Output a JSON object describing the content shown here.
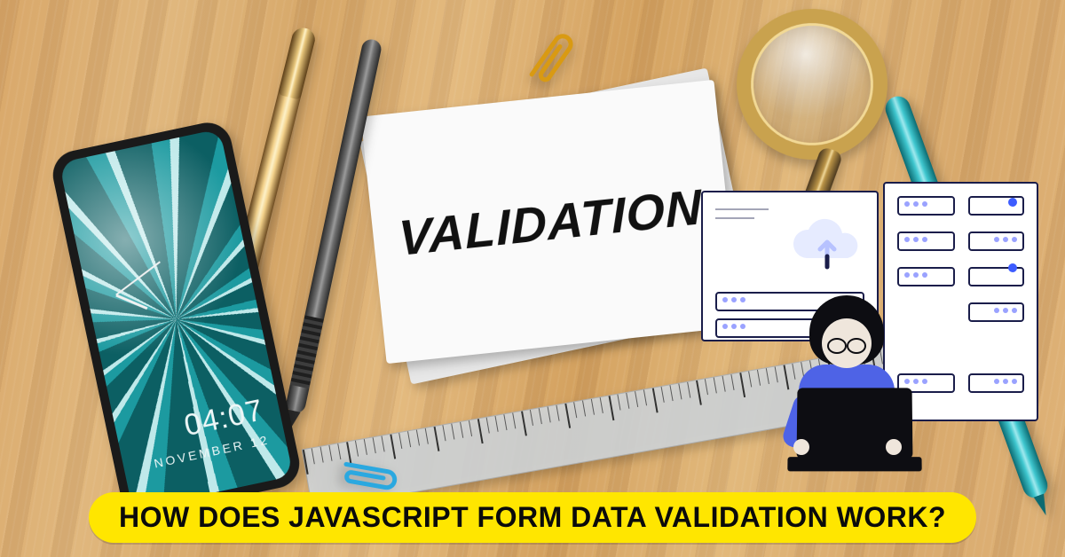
{
  "card_label": "VALIDATION",
  "caption": "HOW DOES JAVASCRIPT FORM DATA VALIDATION WORK?",
  "phone": {
    "time": "04:07",
    "date": "NOVEMBER 12"
  },
  "colors": {
    "caption_bg": "#ffe600",
    "accent_blue": "#3d5cff",
    "teal": "#3fc7cf"
  }
}
